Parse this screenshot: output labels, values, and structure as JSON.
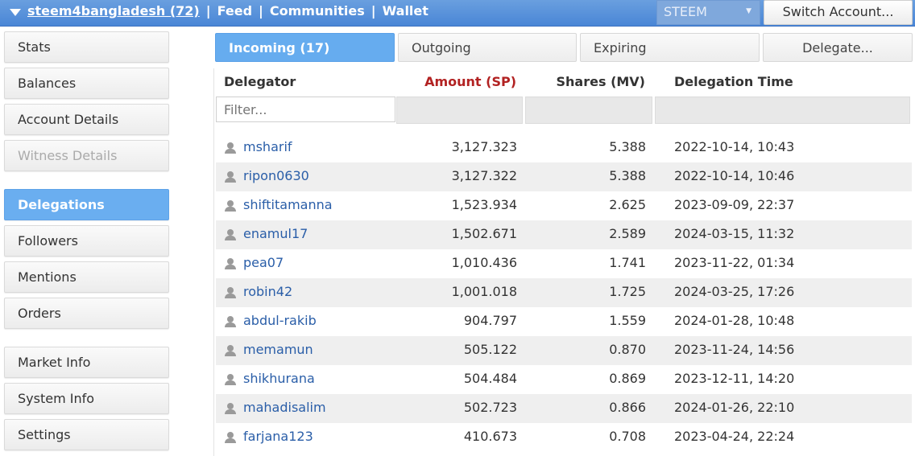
{
  "topbar": {
    "account_label": "steem4bangladesh (72)",
    "sep": "|",
    "feed_label": "Feed",
    "communities_label": "Communities",
    "wallet_label": "Wallet",
    "coin_selected": "STEEM",
    "switch_account_label": "Switch Account..."
  },
  "sidebar": {
    "items": [
      {
        "label": "Stats"
      },
      {
        "label": "Balances"
      },
      {
        "label": "Account Details"
      },
      {
        "label": "Witness Details"
      },
      {
        "label": "Delegations"
      },
      {
        "label": "Followers"
      },
      {
        "label": "Mentions"
      },
      {
        "label": "Orders"
      },
      {
        "label": "Market Info"
      },
      {
        "label": "System Info"
      },
      {
        "label": "Settings"
      }
    ],
    "active": "Delegations",
    "disabled": [
      "Witness Details"
    ]
  },
  "tabs": {
    "incoming": "Incoming (17)",
    "outgoing": "Outgoing",
    "expiring": "Expiring",
    "delegate": "Delegate..."
  },
  "table": {
    "headers": {
      "delegator": "Delegator",
      "amount": "Amount (SP)",
      "shares": "Shares (MV)",
      "time": "Delegation Time"
    },
    "filter_placeholder": "Filter...",
    "rows": [
      {
        "name": "msharif",
        "amount": "3,127.323",
        "shares": "5.388",
        "time": "2022-10-14, 10:43"
      },
      {
        "name": "ripon0630",
        "amount": "3,127.322",
        "shares": "5.388",
        "time": "2022-10-14, 10:46"
      },
      {
        "name": "shiftitamanna",
        "amount": "1,523.934",
        "shares": "2.625",
        "time": "2023-09-09, 22:37"
      },
      {
        "name": "enamul17",
        "amount": "1,502.671",
        "shares": "2.589",
        "time": "2024-03-15, 11:32"
      },
      {
        "name": "pea07",
        "amount": "1,010.436",
        "shares": "1.741",
        "time": "2023-11-22, 01:34"
      },
      {
        "name": "robin42",
        "amount": "1,001.018",
        "shares": "1.725",
        "time": "2024-03-25, 17:26"
      },
      {
        "name": "abdul-rakib",
        "amount": "904.797",
        "shares": "1.559",
        "time": "2024-01-28, 10:48"
      },
      {
        "name": "memamun",
        "amount": "505.122",
        "shares": "0.870",
        "time": "2023-11-24, 14:56"
      },
      {
        "name": "shikhurana",
        "amount": "504.484",
        "shares": "0.869",
        "time": "2023-12-11, 14:20"
      },
      {
        "name": "mahadisalim",
        "amount": "502.723",
        "shares": "0.866",
        "time": "2024-01-26, 22:10"
      },
      {
        "name": "farjana123",
        "amount": "410.673",
        "shares": "0.708",
        "time": "2023-04-24, 22:24"
      }
    ]
  },
  "colors": {
    "topbar": "#4a86d6",
    "active_blue": "#66acef",
    "amount_header": "#b22222",
    "link": "#2a5ea8"
  }
}
